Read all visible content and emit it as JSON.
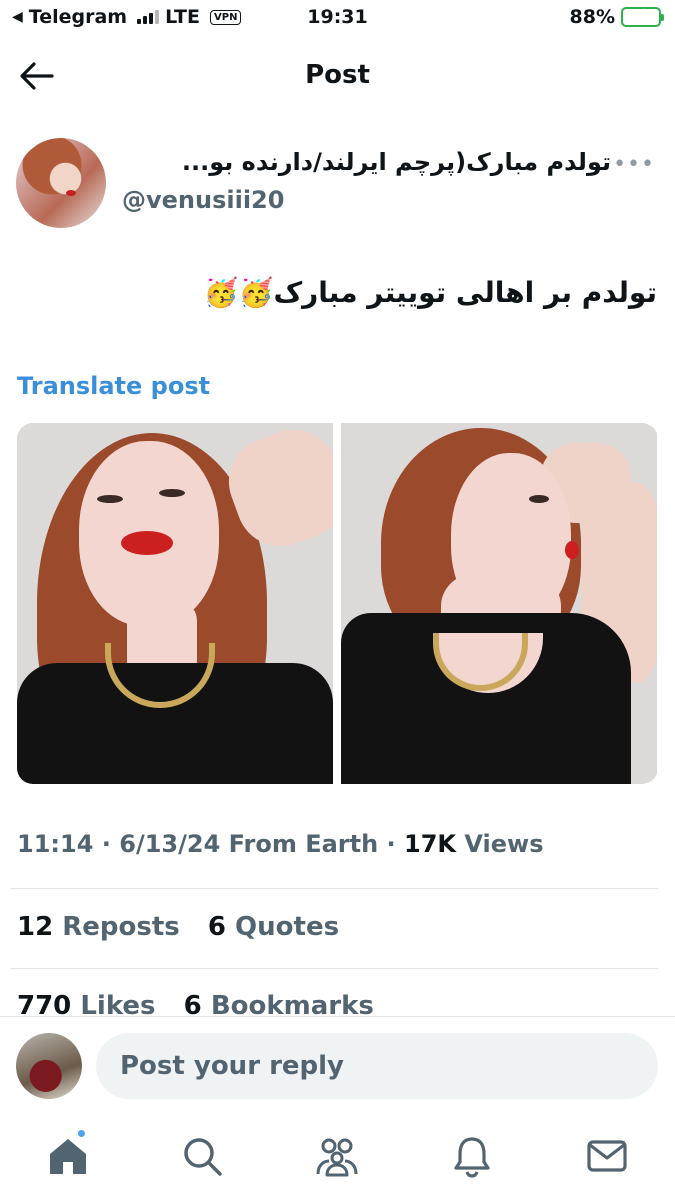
{
  "status_bar": {
    "back_app": "Telegram",
    "network": "LTE",
    "vpn": "VPN",
    "time": "19:31",
    "battery_percent": "88%",
    "battery_level": 0.88,
    "battery_color": "#34c759"
  },
  "header": {
    "title": "Post",
    "back_icon": "arrow-left-icon"
  },
  "author": {
    "display_name": "تولدم مبارک(پرچم ایرلند/دارنده بو...",
    "handle": "@venusiii20"
  },
  "post": {
    "text": "تولدم بر اهالی توییتر مبارک🥳🥳",
    "translate_label": "Translate post",
    "translate_color": "#3b8fd9"
  },
  "meta": {
    "time": "11:14",
    "date": "6/13/24",
    "source": "From Earth",
    "views_count": "17K",
    "views_label": "Views"
  },
  "stats": {
    "reposts_count": "12",
    "reposts_label": "Reposts",
    "quotes_count": "6",
    "quotes_label": "Quotes",
    "likes_count": "770",
    "likes_label": "Likes",
    "bookmarks_count": "6",
    "bookmarks_label": "Bookmarks"
  },
  "reply": {
    "placeholder": "Post your reply"
  },
  "tabs": [
    "home-icon",
    "search-icon",
    "communities-icon",
    "notifications-icon",
    "messages-icon"
  ]
}
